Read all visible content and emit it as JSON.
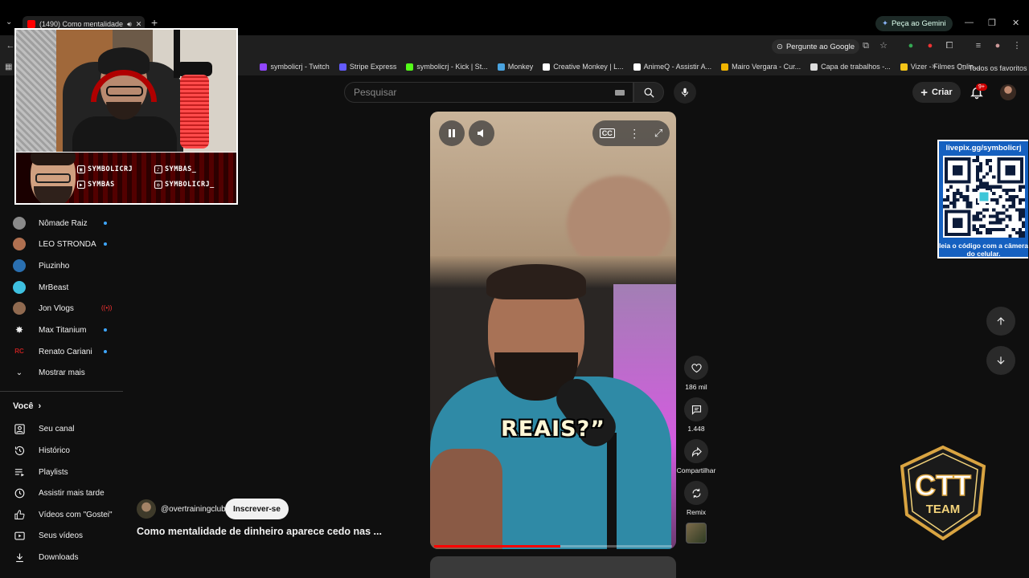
{
  "browser": {
    "tab_title": "(1490) Como mentalidade ",
    "gemini_label": "Peça ao Gemini",
    "omnibox_action": "Pergunte ao Google",
    "bookmarks": [
      {
        "label": "symbolicrj - Twitch",
        "color": "#9146ff"
      },
      {
        "label": "Stripe Express",
        "color": "#635bff"
      },
      {
        "label": "symbolicrj - Kick | St...",
        "color": "#53fc18"
      },
      {
        "label": "Monkey",
        "color": "#4aa3df"
      },
      {
        "label": "Creative Monkey | L...",
        "color": "#ffffff"
      },
      {
        "label": "AnimeQ - Assistir A...",
        "color": "#ffffff"
      },
      {
        "label": "Mairo Vergara - Cur...",
        "color": "#f0b400"
      },
      {
        "label": "Capa de trabalhos -...",
        "color": "#dddddd"
      },
      {
        "label": "Vizer - Filmes Onlin...",
        "color": "#f5c518"
      }
    ],
    "more_bookmarks": "»",
    "all_bookmarks": "Todos os favoritos"
  },
  "header": {
    "search_placeholder": "Pesquisar",
    "create_label": "Criar",
    "notifications_badge": "9+"
  },
  "sidebar": {
    "subscriptions": [
      {
        "name": "Nômade Raiz",
        "status": "dot",
        "color": "#8a8a8a"
      },
      {
        "name": "LEO STRONDA",
        "status": "dot",
        "color": "#b07050"
      },
      {
        "name": "Piuzinho",
        "status": "none",
        "color": "#2a6fb0"
      },
      {
        "name": "MrBeast",
        "status": "none",
        "color": "#3ec0e0"
      },
      {
        "name": "Jon Vlogs",
        "status": "live",
        "color": "#906a50"
      },
      {
        "name": "Max Titanium",
        "status": "dot",
        "color": "#eeeeee"
      },
      {
        "name": "Renato Cariani",
        "status": "dot",
        "color": "#c02020"
      }
    ],
    "show_more": "Mostrar mais",
    "you_heading": "Você",
    "you_items": [
      {
        "label": "Seu canal",
        "icon": "account-box-icon"
      },
      {
        "label": "Histórico",
        "icon": "history-icon"
      },
      {
        "label": "Playlists",
        "icon": "playlists-icon"
      },
      {
        "label": "Assistir mais tarde",
        "icon": "clock-icon"
      },
      {
        "label": "Vídeos com \"Gostei\"",
        "icon": "thumbs-up-icon"
      },
      {
        "label": "Seus vídeos",
        "icon": "video-icon"
      },
      {
        "label": "Downloads",
        "icon": "download-icon"
      }
    ]
  },
  "overlay": {
    "handles": [
      {
        "text": "SYMBOLICRJ",
        "icon": "twitch-icon"
      },
      {
        "text": "SYMBAS_",
        "icon": "tiktok-icon"
      },
      {
        "text": "SYMBAS",
        "icon": "youtube-icon"
      },
      {
        "text": "SYMBOLICRJ_",
        "icon": "instagram-icon"
      }
    ],
    "qr_url": "livepix.gg/symbolicrj",
    "qr_caption": "leia o código com a câmera do celular.",
    "logo_text_top": "CTT",
    "logo_text_bottom": "TEAM"
  },
  "short": {
    "caption": "REAIS?”",
    "progress": 0.53,
    "channel_handle": "@overtrainingclub",
    "subscribe_label": "Inscrever-se",
    "title": "Como mentalidade de dinheiro aparece cedo nas ...",
    "likes": "186 mil",
    "comments": "1.448",
    "share_label": "Compartilhar",
    "remix_label": "Remix"
  }
}
